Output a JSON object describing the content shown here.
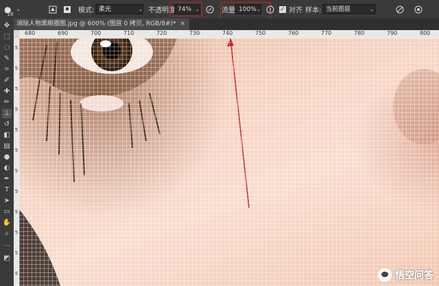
{
  "options_bar": {
    "brush_size": "18",
    "mode_label": "模式:",
    "mode_value": "柔光",
    "opacity_label": "不透明度:",
    "opacity_value": "74%",
    "flow_label": "流量:",
    "flow_value": "100%",
    "aligned_label": "对齐",
    "sample_label": "样本:",
    "sample_value": "当前图层"
  },
  "document_tab": {
    "title": "消除人物黑眼圈图.jpg @ 600% (图层 0 拷贝, RGB/8#)",
    "modified_mark": "*"
  },
  "ruler": {
    "h_ticks": [
      "680",
      "690",
      "700",
      "710",
      "720",
      "730",
      "740",
      "750",
      "760",
      "770",
      "780",
      "790",
      "800"
    ],
    "v_ticks": [
      "5",
      "5",
      "5",
      "5",
      "5",
      "5",
      "5",
      "5",
      "5",
      "5",
      "5",
      "5"
    ]
  },
  "watermark": {
    "text": "悟空问答"
  },
  "colors": {
    "highlight": "#d61c1c",
    "arrow": "#c62020"
  }
}
